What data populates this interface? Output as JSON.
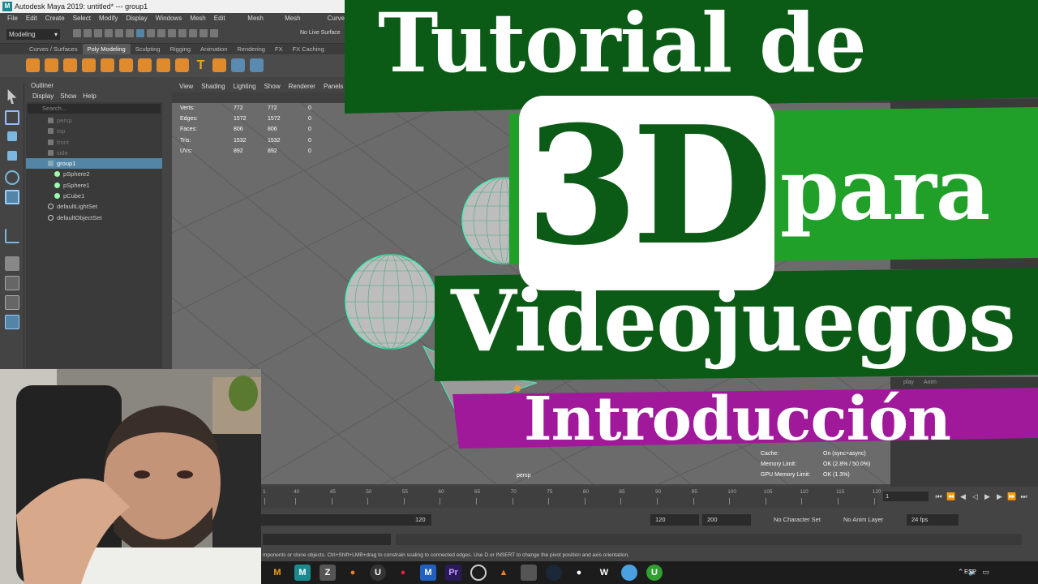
{
  "window": {
    "title": "Autodesk Maya 2019: untitled*   ---   group1"
  },
  "menu": [
    "File",
    "Edit",
    "Create",
    "Select",
    "Modify",
    "Display",
    "Windows",
    "Mesh",
    "Edit Mesh",
    "Mesh Tools",
    "Mesh Display",
    "Curve"
  ],
  "statusline": {
    "mode": "Modeling",
    "live_surface": "No Live Surface"
  },
  "shelf_tabs": [
    "Curves / Surfaces",
    "Poly Modeling",
    "Sculpting",
    "Rigging",
    "Animation",
    "Rendering",
    "FX",
    "FX Caching"
  ],
  "shelf_active": "Poly Modeling",
  "outliner": {
    "title": "Outliner",
    "menu": [
      "Display",
      "Show",
      "Help"
    ],
    "search_placeholder": "Search...",
    "items": [
      {
        "label": "persp",
        "dim": true,
        "indent": 0,
        "icon": "camera-icon"
      },
      {
        "label": "top",
        "dim": true,
        "indent": 0,
        "icon": "camera-icon"
      },
      {
        "label": "front",
        "dim": true,
        "indent": 0,
        "icon": "camera-icon"
      },
      {
        "label": "side",
        "dim": true,
        "indent": 0,
        "icon": "camera-icon"
      },
      {
        "label": "group1",
        "selected": true,
        "indent": 0,
        "icon": "group-icon"
      },
      {
        "label": "pSphere2",
        "indent": 1,
        "icon": "mesh-icon"
      },
      {
        "label": "pSphere1",
        "indent": 1,
        "icon": "mesh-icon"
      },
      {
        "label": "pCube1",
        "indent": 1,
        "icon": "mesh-icon"
      },
      {
        "label": "defaultLightSet",
        "indent": 0,
        "icon": "set-icon"
      },
      {
        "label": "defaultObjectSet",
        "indent": 0,
        "icon": "set-icon"
      }
    ]
  },
  "viewport": {
    "menu": [
      "View",
      "Shading",
      "Lighting",
      "Show",
      "Renderer",
      "Panels"
    ],
    "hud": [
      {
        "label": "Verts:",
        "a": "772",
        "b": "772",
        "c": "0"
      },
      {
        "label": "Edges:",
        "a": "1572",
        "b": "1572",
        "c": "0"
      },
      {
        "label": "Faces:",
        "a": "806",
        "b": "806",
        "c": "0"
      },
      {
        "label": "Tris:",
        "a": "1532",
        "b": "1532",
        "c": "0"
      },
      {
        "label": "UVs:",
        "a": "892",
        "b": "892",
        "c": "0"
      }
    ],
    "cache_hud": [
      {
        "label": "Cache:",
        "value": "On (sync+async)"
      },
      {
        "label": "Memory Limit:",
        "value": "OK (2.8% / 50.0%)"
      },
      {
        "label": "GPU Memory Limit:",
        "value": "OK (1.3%)"
      }
    ],
    "camera": "persp"
  },
  "right_panel_tabs": [
    "play",
    "Anim"
  ],
  "timeline": {
    "ticks": [
      "1",
      "40",
      "45",
      "50",
      "55",
      "60",
      "65",
      "70",
      "75",
      "80",
      "85",
      "90",
      "95",
      "100",
      "105",
      "110",
      "115",
      "120"
    ],
    "current_frame": "1",
    "range_end": "120",
    "start": "120",
    "end": "200",
    "character_set": "No Character Set",
    "anim_layer": "No Anim Layer",
    "fps": "24 fps"
  },
  "helpline": "mponents or clone objects. Ctrl+Shift+LMB+drag to constrain scaling to connected edges. Use D or INSERT to change the pivot position and axis orientation.",
  "taskbar": {
    "lang": "ESP"
  },
  "banner": {
    "line1": "Tutorial de",
    "line2_big": "3D",
    "line2_small": "para",
    "line3": "Videojuegos",
    "line4": "Introducción",
    "colors": {
      "dark_green": "#0b5a16",
      "green": "#20a028",
      "magenta": "#a0199a"
    }
  }
}
